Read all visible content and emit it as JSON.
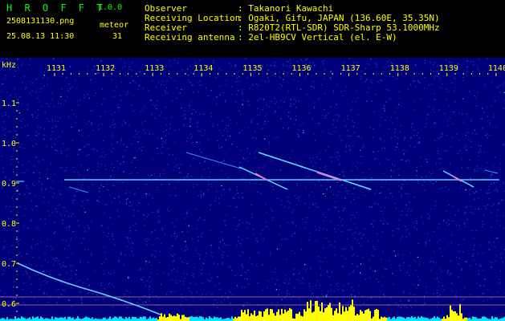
{
  "app": {
    "name": "H R O F F T",
    "version": "1.0.0"
  },
  "file_name": "2508131130.png",
  "datetime": "25.08.13 11:30",
  "meteor": {
    "label": "meteor",
    "count": "31"
  },
  "info": [
    {
      "label": "Observer",
      "value": ": Takanori Kawachi"
    },
    {
      "label": "Receiving Location",
      "value": ": Ogaki, Gifu, JAPAN (136.60E, 35.35N)"
    },
    {
      "label": "Receiver",
      "value": ": R820T2(RTL-SDR) SDR-Sharp 53.1000MHz"
    },
    {
      "label": "Receiving antenna",
      "value": ": 2el-HB9CV Vertical (el. E-W)"
    }
  ],
  "y_axis": {
    "unit": "kHz",
    "ticks": [
      "1.1",
      "1.0",
      "0.9",
      "0.8",
      "0.7",
      "0.6"
    ]
  },
  "x_axis": {
    "ticks": [
      "1131",
      "1132",
      "1133",
      "1134",
      "1135",
      "1136",
      "1137",
      "1138",
      "1139",
      "1140"
    ]
  },
  "colors": {
    "background": "#000000",
    "spectrogram_bg": "#00007a",
    "noise": "#2a3ad0",
    "header_text": "#ffff00",
    "title_text": "#00ff00",
    "carrier": "#33ccff",
    "histogram_yellow": "#ffff00",
    "histogram_cyan": "#00e5ff"
  }
}
